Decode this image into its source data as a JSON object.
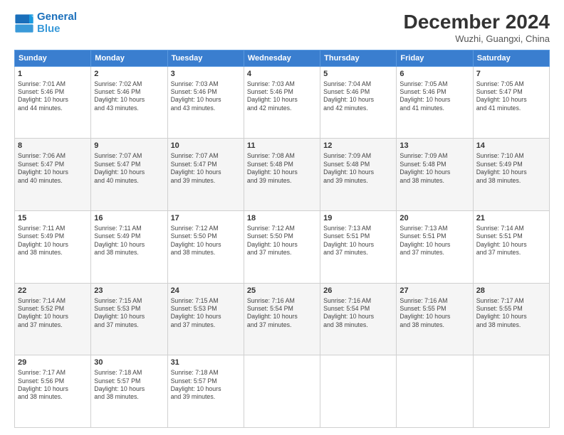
{
  "logo": {
    "line1": "General",
    "line2": "Blue"
  },
  "title": "December 2024",
  "location": "Wuzhi, Guangxi, China",
  "days_header": [
    "Sunday",
    "Monday",
    "Tuesday",
    "Wednesday",
    "Thursday",
    "Friday",
    "Saturday"
  ],
  "weeks": [
    [
      {
        "day": "1",
        "info": "Sunrise: 7:01 AM\nSunset: 5:46 PM\nDaylight: 10 hours\nand 44 minutes."
      },
      {
        "day": "2",
        "info": "Sunrise: 7:02 AM\nSunset: 5:46 PM\nDaylight: 10 hours\nand 43 minutes."
      },
      {
        "day": "3",
        "info": "Sunrise: 7:03 AM\nSunset: 5:46 PM\nDaylight: 10 hours\nand 43 minutes."
      },
      {
        "day": "4",
        "info": "Sunrise: 7:03 AM\nSunset: 5:46 PM\nDaylight: 10 hours\nand 42 minutes."
      },
      {
        "day": "5",
        "info": "Sunrise: 7:04 AM\nSunset: 5:46 PM\nDaylight: 10 hours\nand 42 minutes."
      },
      {
        "day": "6",
        "info": "Sunrise: 7:05 AM\nSunset: 5:46 PM\nDaylight: 10 hours\nand 41 minutes."
      },
      {
        "day": "7",
        "info": "Sunrise: 7:05 AM\nSunset: 5:47 PM\nDaylight: 10 hours\nand 41 minutes."
      }
    ],
    [
      {
        "day": "8",
        "info": "Sunrise: 7:06 AM\nSunset: 5:47 PM\nDaylight: 10 hours\nand 40 minutes."
      },
      {
        "day": "9",
        "info": "Sunrise: 7:07 AM\nSunset: 5:47 PM\nDaylight: 10 hours\nand 40 minutes."
      },
      {
        "day": "10",
        "info": "Sunrise: 7:07 AM\nSunset: 5:47 PM\nDaylight: 10 hours\nand 39 minutes."
      },
      {
        "day": "11",
        "info": "Sunrise: 7:08 AM\nSunset: 5:48 PM\nDaylight: 10 hours\nand 39 minutes."
      },
      {
        "day": "12",
        "info": "Sunrise: 7:09 AM\nSunset: 5:48 PM\nDaylight: 10 hours\nand 39 minutes."
      },
      {
        "day": "13",
        "info": "Sunrise: 7:09 AM\nSunset: 5:48 PM\nDaylight: 10 hours\nand 38 minutes."
      },
      {
        "day": "14",
        "info": "Sunrise: 7:10 AM\nSunset: 5:49 PM\nDaylight: 10 hours\nand 38 minutes."
      }
    ],
    [
      {
        "day": "15",
        "info": "Sunrise: 7:11 AM\nSunset: 5:49 PM\nDaylight: 10 hours\nand 38 minutes."
      },
      {
        "day": "16",
        "info": "Sunrise: 7:11 AM\nSunset: 5:49 PM\nDaylight: 10 hours\nand 38 minutes."
      },
      {
        "day": "17",
        "info": "Sunrise: 7:12 AM\nSunset: 5:50 PM\nDaylight: 10 hours\nand 38 minutes."
      },
      {
        "day": "18",
        "info": "Sunrise: 7:12 AM\nSunset: 5:50 PM\nDaylight: 10 hours\nand 37 minutes."
      },
      {
        "day": "19",
        "info": "Sunrise: 7:13 AM\nSunset: 5:51 PM\nDaylight: 10 hours\nand 37 minutes."
      },
      {
        "day": "20",
        "info": "Sunrise: 7:13 AM\nSunset: 5:51 PM\nDaylight: 10 hours\nand 37 minutes."
      },
      {
        "day": "21",
        "info": "Sunrise: 7:14 AM\nSunset: 5:51 PM\nDaylight: 10 hours\nand 37 minutes."
      }
    ],
    [
      {
        "day": "22",
        "info": "Sunrise: 7:14 AM\nSunset: 5:52 PM\nDaylight: 10 hours\nand 37 minutes."
      },
      {
        "day": "23",
        "info": "Sunrise: 7:15 AM\nSunset: 5:53 PM\nDaylight: 10 hours\nand 37 minutes."
      },
      {
        "day": "24",
        "info": "Sunrise: 7:15 AM\nSunset: 5:53 PM\nDaylight: 10 hours\nand 37 minutes."
      },
      {
        "day": "25",
        "info": "Sunrise: 7:16 AM\nSunset: 5:54 PM\nDaylight: 10 hours\nand 37 minutes."
      },
      {
        "day": "26",
        "info": "Sunrise: 7:16 AM\nSunset: 5:54 PM\nDaylight: 10 hours\nand 38 minutes."
      },
      {
        "day": "27",
        "info": "Sunrise: 7:16 AM\nSunset: 5:55 PM\nDaylight: 10 hours\nand 38 minutes."
      },
      {
        "day": "28",
        "info": "Sunrise: 7:17 AM\nSunset: 5:55 PM\nDaylight: 10 hours\nand 38 minutes."
      }
    ],
    [
      {
        "day": "29",
        "info": "Sunrise: 7:17 AM\nSunset: 5:56 PM\nDaylight: 10 hours\nand 38 minutes."
      },
      {
        "day": "30",
        "info": "Sunrise: 7:18 AM\nSunset: 5:57 PM\nDaylight: 10 hours\nand 38 minutes."
      },
      {
        "day": "31",
        "info": "Sunrise: 7:18 AM\nSunset: 5:57 PM\nDaylight: 10 hours\nand 39 minutes."
      },
      {
        "day": "",
        "info": ""
      },
      {
        "day": "",
        "info": ""
      },
      {
        "day": "",
        "info": ""
      },
      {
        "day": "",
        "info": ""
      }
    ]
  ]
}
